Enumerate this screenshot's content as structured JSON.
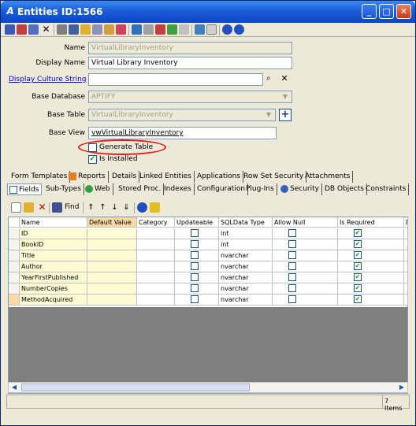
{
  "window": {
    "title": "Entities ID:1566",
    "app_icon": "A"
  },
  "form": {
    "name_label": "Name",
    "name_value": "VirtualLibraryInventory",
    "display_name_label": "Display Name",
    "display_name_value": "Virtual Library Inventory",
    "display_culture_label": "Display Culture String",
    "display_culture_value": "",
    "base_db_label": "Base Database",
    "base_db_value": "APTIFY",
    "base_table_label": "Base Table",
    "base_table_value": "VirtualLibraryInventory",
    "base_view_label": "Base View",
    "base_view_value": "vwVirtualLibraryInventory",
    "generate_table_label": "Generate Table",
    "generate_table_checked": false,
    "is_installed_label": "Is Installed",
    "is_installed_checked": true
  },
  "tabs_row1": [
    "Form Templates",
    "Reports",
    "Details",
    "Linked Entities",
    "Applications",
    "Row Set Security",
    "Attachments"
  ],
  "tabs_row2": [
    "Fields",
    "Sub-Types",
    "Web",
    "Stored Proc.",
    "Indexes",
    "Configuration",
    "Plug-Ins",
    "Security",
    "DB Objects",
    "Constraints"
  ],
  "grid_toolbar": {
    "find_label": "Find"
  },
  "grid": {
    "columns": [
      "Name",
      "Default Value",
      "Category",
      "Updateable",
      "SQLData Type",
      "Allow Null",
      "Is Required",
      "D"
    ],
    "rows": [
      {
        "name": "ID",
        "type": "int",
        "updateable": false,
        "allow_null": false,
        "required": true
      },
      {
        "name": "BookID",
        "type": "int",
        "updateable": false,
        "allow_null": false,
        "required": true
      },
      {
        "name": "Title",
        "type": "nvarchar",
        "updateable": false,
        "allow_null": false,
        "required": true
      },
      {
        "name": "Author",
        "type": "nvarchar",
        "updateable": false,
        "allow_null": false,
        "required": true
      },
      {
        "name": "YearFirstPublished",
        "type": "nvarchar",
        "updateable": false,
        "allow_null": false,
        "required": true
      },
      {
        "name": "NumberCopies",
        "type": "nvarchar",
        "updateable": false,
        "allow_null": false,
        "required": true
      },
      {
        "name": "MethodAcquired",
        "type": "nvarchar",
        "updateable": false,
        "allow_null": false,
        "required": true
      }
    ]
  },
  "status": {
    "items": "7 Items"
  },
  "colors": {
    "titlebar": "#0a46c8",
    "highlight_row": "#fdfbd3",
    "header_highlight": "#fbd9a6",
    "circle": "#e02020"
  }
}
